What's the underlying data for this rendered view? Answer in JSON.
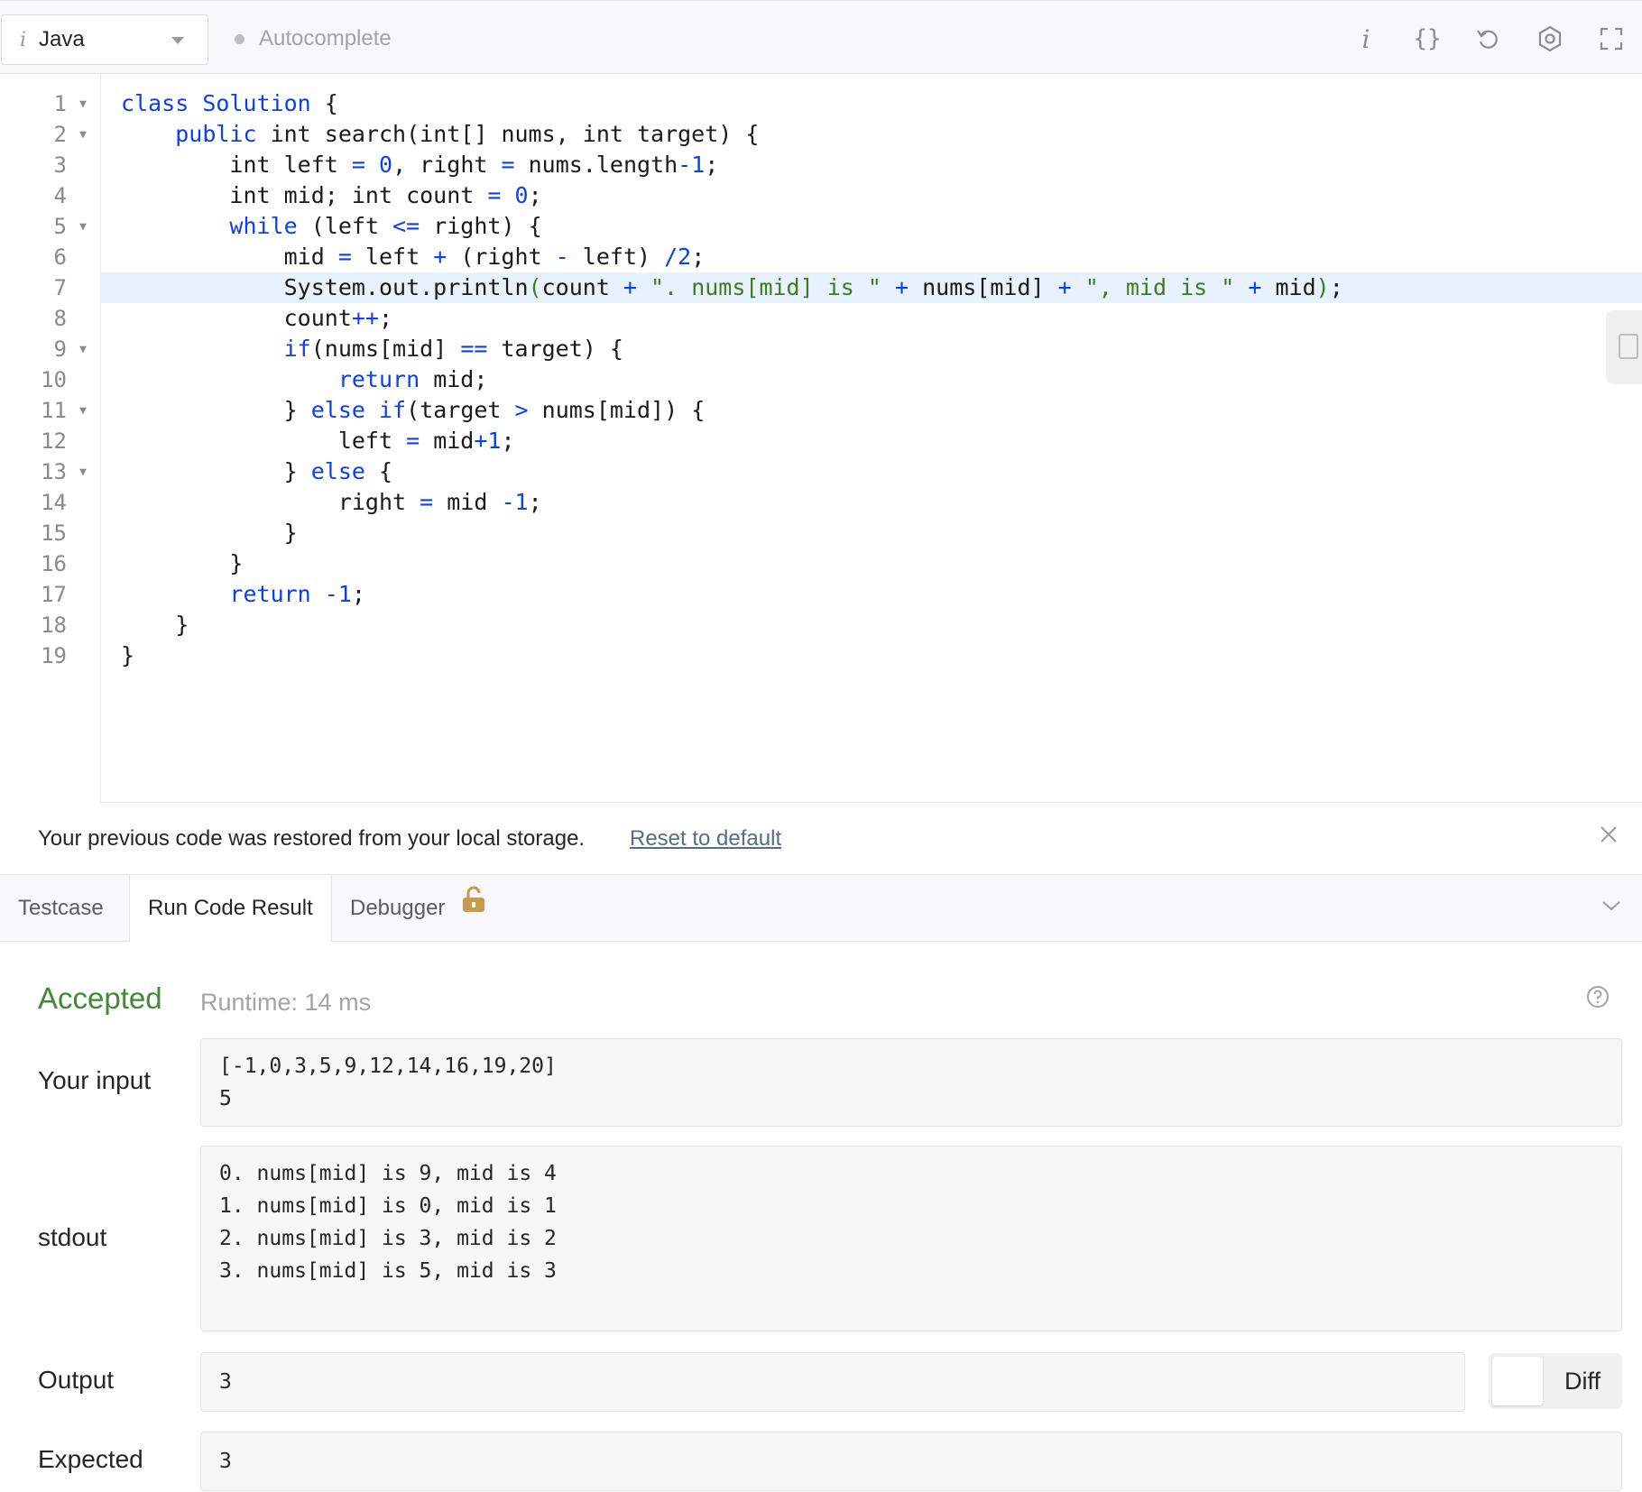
{
  "toolbar": {
    "language": "Java",
    "autocomplete_label": "Autocomplete",
    "icons": [
      "info-icon",
      "format-braces-icon",
      "reset-icon",
      "settings-icon",
      "fullscreen-icon"
    ],
    "format_glyph": "{}",
    "info_glyph": "i"
  },
  "editor": {
    "active_line": 7,
    "lines": [
      {
        "n": "1",
        "fold": true
      },
      {
        "n": "2",
        "fold": true
      },
      {
        "n": "3",
        "fold": false
      },
      {
        "n": "4",
        "fold": false
      },
      {
        "n": "5",
        "fold": true
      },
      {
        "n": "6",
        "fold": false
      },
      {
        "n": "7",
        "fold": false
      },
      {
        "n": "8",
        "fold": false
      },
      {
        "n": "9",
        "fold": true
      },
      {
        "n": "10",
        "fold": false
      },
      {
        "n": "11",
        "fold": true
      },
      {
        "n": "12",
        "fold": false
      },
      {
        "n": "13",
        "fold": true
      },
      {
        "n": "14",
        "fold": false
      },
      {
        "n": "15",
        "fold": false
      },
      {
        "n": "16",
        "fold": false
      },
      {
        "n": "17",
        "fold": false
      },
      {
        "n": "18",
        "fold": false
      },
      {
        "n": "19",
        "fold": false
      }
    ],
    "code": [
      [
        [
          "k",
          "class"
        ],
        [
          "p",
          " "
        ],
        [
          "c",
          "Solution"
        ],
        [
          "p",
          " {"
        ]
      ],
      [
        [
          "p",
          "    "
        ],
        [
          "k",
          "public"
        ],
        [
          "p",
          " int search(int[] nums, int target) {"
        ]
      ],
      [
        [
          "p",
          "        int left "
        ],
        [
          "o",
          "="
        ],
        [
          "p",
          " "
        ],
        [
          "n",
          "0"
        ],
        [
          "p",
          ", right "
        ],
        [
          "o",
          "="
        ],
        [
          "p",
          " nums.length"
        ],
        [
          "o",
          "-"
        ],
        [
          "n",
          "1"
        ],
        [
          "p",
          ";"
        ]
      ],
      [
        [
          "p",
          "        int mid; int count "
        ],
        [
          "o",
          "="
        ],
        [
          "p",
          " "
        ],
        [
          "n",
          "0"
        ],
        [
          "p",
          ";"
        ]
      ],
      [
        [
          "p",
          "        "
        ],
        [
          "k",
          "while"
        ],
        [
          "p",
          " (left "
        ],
        [
          "o",
          "<="
        ],
        [
          "p",
          " right) {"
        ]
      ],
      [
        [
          "p",
          "            mid "
        ],
        [
          "o",
          "="
        ],
        [
          "p",
          " left "
        ],
        [
          "o",
          "+"
        ],
        [
          "p",
          " (right "
        ],
        [
          "o",
          "-"
        ],
        [
          "p",
          " left) "
        ],
        [
          "o",
          "/"
        ],
        [
          "n",
          "2"
        ],
        [
          "p",
          ";"
        ]
      ],
      [
        [
          "p",
          "            System.out.println"
        ],
        [
          "s",
          "("
        ],
        [
          "p",
          "count "
        ],
        [
          "o",
          "+"
        ],
        [
          "p",
          " "
        ],
        [
          "s",
          "\". nums[mid] is \""
        ],
        [
          "p",
          " "
        ],
        [
          "o",
          "+"
        ],
        [
          "p",
          " nums[mid] "
        ],
        [
          "o",
          "+"
        ],
        [
          "p",
          " "
        ],
        [
          "s",
          "\", mid is \""
        ],
        [
          "p",
          " "
        ],
        [
          "o",
          "+"
        ],
        [
          "p",
          " mid"
        ],
        [
          "s",
          ")"
        ],
        [
          "p",
          ";"
        ]
      ],
      [
        [
          "p",
          "            count"
        ],
        [
          "o",
          "++"
        ],
        [
          "p",
          ";"
        ]
      ],
      [
        [
          "p",
          "            "
        ],
        [
          "k",
          "if"
        ],
        [
          "p",
          "(nums[mid] "
        ],
        [
          "o",
          "=="
        ],
        [
          "p",
          " target) {"
        ]
      ],
      [
        [
          "p",
          "                "
        ],
        [
          "k",
          "return"
        ],
        [
          "p",
          " mid;"
        ]
      ],
      [
        [
          "p",
          "            } "
        ],
        [
          "k",
          "else"
        ],
        [
          "p",
          " "
        ],
        [
          "k",
          "if"
        ],
        [
          "p",
          "(target "
        ],
        [
          "o",
          ">"
        ],
        [
          "p",
          " nums[mid]) {"
        ]
      ],
      [
        [
          "p",
          "                left "
        ],
        [
          "o",
          "="
        ],
        [
          "p",
          " mid"
        ],
        [
          "o",
          "+"
        ],
        [
          "n",
          "1"
        ],
        [
          "p",
          ";"
        ]
      ],
      [
        [
          "p",
          "            } "
        ],
        [
          "k",
          "else"
        ],
        [
          "p",
          " {"
        ]
      ],
      [
        [
          "p",
          "                right "
        ],
        [
          "o",
          "="
        ],
        [
          "p",
          " mid "
        ],
        [
          "o",
          "-"
        ],
        [
          "n",
          "1"
        ],
        [
          "p",
          ";"
        ]
      ],
      [
        [
          "p",
          "            }"
        ]
      ],
      [
        [
          "p",
          "        }"
        ]
      ],
      [
        [
          "p",
          "        "
        ],
        [
          "k",
          "return"
        ],
        [
          "p",
          " "
        ],
        [
          "o",
          "-"
        ],
        [
          "n",
          "1"
        ],
        [
          "p",
          ";"
        ]
      ],
      [
        [
          "p",
          "    }"
        ]
      ],
      [
        [
          "p",
          "}"
        ]
      ]
    ],
    "colors": {
      "keyword": "#0b3ff0",
      "string": "#3e7d1e",
      "active_line_bg": "#e8f2ff"
    }
  },
  "notice": {
    "message": "Your previous code was restored from your local storage.",
    "reset_link": "Reset to default"
  },
  "tabs": [
    {
      "label": "Testcase",
      "active": false
    },
    {
      "label": "Run Code Result",
      "active": true
    },
    {
      "label": "Debugger",
      "active": false,
      "locked": true
    }
  ],
  "result": {
    "status": "Accepted",
    "status_color": "#3e8a35",
    "runtime": "Runtime: 14 ms",
    "input_label": "Your input",
    "input_lines": [
      "[-1,0,3,5,9,12,14,16,19,20]",
      "5"
    ],
    "stdout_label": "stdout",
    "stdout_lines": [
      "0. nums[mid] is 9, mid is 4",
      "1. nums[mid] is 0, mid is 1",
      "2. nums[mid] is 3, mid is 2",
      "3. nums[mid] is 5, mid is 3"
    ],
    "output_label": "Output",
    "output_value": "3",
    "diff_label": "Diff",
    "expected_label": "Expected",
    "expected_value": "3"
  }
}
